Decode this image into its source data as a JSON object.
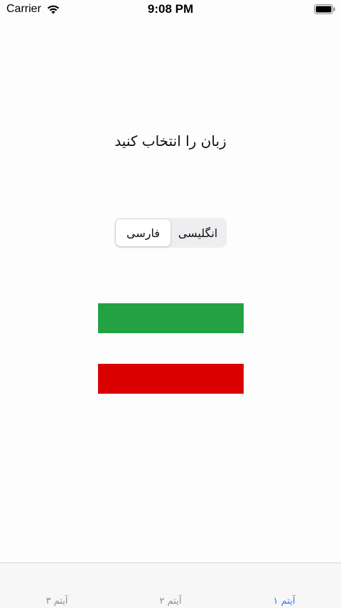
{
  "status_bar": {
    "carrier": "Carrier",
    "time": "9:08 PM",
    "wifi_icon": "wifi-icon",
    "battery_icon": "battery-icon"
  },
  "main": {
    "title": "زبان را انتخاب کنید",
    "language_selector": {
      "options": [
        "فارسی",
        "انگلیسی"
      ],
      "selected": "فارسی"
    },
    "flag_colors": {
      "green": "#23a143",
      "red": "#da0000"
    }
  },
  "tab_bar": {
    "tabs": [
      {
        "label": "آیتم ۱",
        "active": true
      },
      {
        "label": "آیتم ۲",
        "active": false
      },
      {
        "label": "آیتم ۳",
        "active": false
      }
    ],
    "active_color": "#2f7bf5",
    "inactive_color": "#8e8e93"
  }
}
